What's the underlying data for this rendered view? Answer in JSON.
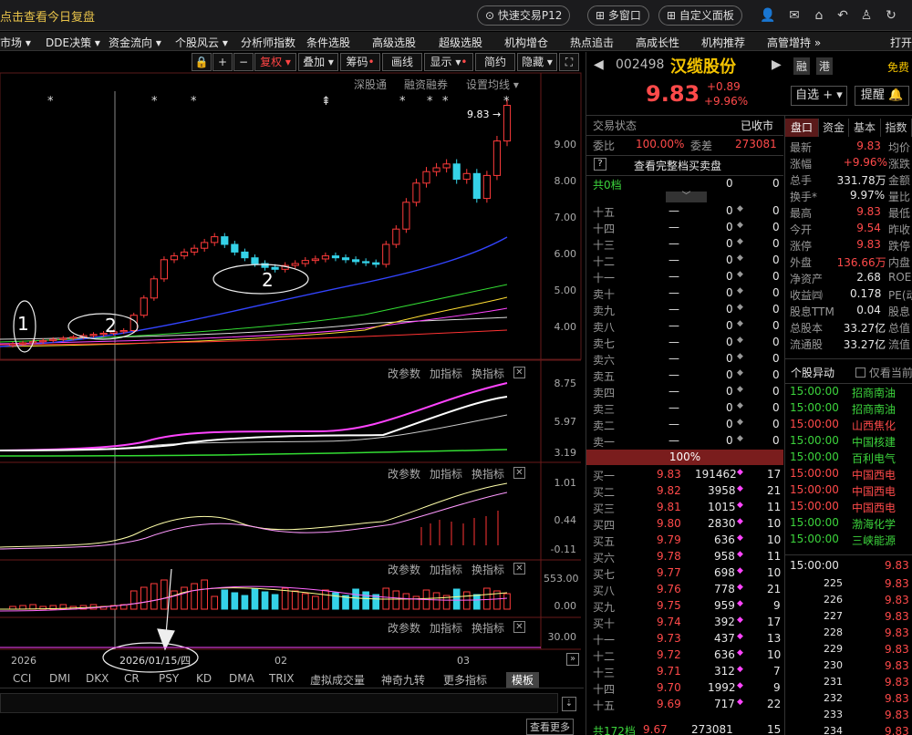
{
  "title": "点击查看今日复盘",
  "top_buttons": {
    "quick_trade": "快速交易P12",
    "multi_window": "多窗口",
    "custom_panel": "自定义面板"
  },
  "menu": [
    "市场 ▾",
    "DDE决策 ▾",
    "资金流向 ▾",
    "个股风云 ▾",
    "分析师指数",
    "条件选股",
    "高级选股",
    "超级选股",
    "机构增仓",
    "热点追击",
    "高成长性",
    "机构推荐",
    "高管增持 »",
    "打开"
  ],
  "toolbar": {
    "fuquan": "复权",
    "overlay": "叠加",
    "chips": "筹码",
    "draw": "画线",
    "display": "显示",
    "simple": "简约",
    "hide": "隐藏"
  },
  "sub_toolbar": [
    "深股通",
    "融资融券",
    "设置均线 ▾"
  ],
  "price_labels": [
    "9.00",
    "8.00",
    "7.00",
    "6.00",
    "5.00",
    "4.00"
  ],
  "price_flag": "9.83",
  "annotations": [
    "1",
    "2",
    "2"
  ],
  "panel_tools": [
    "改参数",
    "加指标",
    "换指标"
  ],
  "p2_labels": [
    "8.75",
    "5.97",
    "3.19"
  ],
  "p3_labels": [
    "1.01",
    "0.44",
    "-0.11"
  ],
  "p4_labels": [
    "553.00",
    "0.00"
  ],
  "p5_labels": [
    "30.00"
  ],
  "x_labels": [
    "2026",
    "2026/01/15/四",
    "02",
    "03"
  ],
  "ind_tabs": [
    "CCI",
    "DMI",
    "DKX",
    "CR",
    "PSY",
    "KD",
    "DMA",
    "TRIX",
    "虚拟成交量",
    "神奇九转",
    "更多指标",
    "模板"
  ],
  "bottom_btn": "查看更多",
  "chart_data": {
    "type": "candlestick",
    "closes": [
      3.6,
      3.63,
      3.66,
      3.69,
      3.72,
      3.75,
      3.78,
      3.82,
      3.85,
      3.88,
      3.92,
      3.95,
      4.35,
      4.8,
      5.3,
      5.8,
      5.9,
      6.0,
      6.1,
      6.25,
      6.4,
      6.2,
      6.0,
      5.85,
      5.7,
      5.6,
      5.55,
      5.65,
      5.7,
      5.78,
      5.82,
      5.9,
      5.85,
      5.8,
      5.75,
      5.72,
      5.68,
      6.2,
      6.6,
      7.3,
      7.8,
      8.1,
      8.2,
      8.3,
      7.9,
      8.05,
      7.4,
      8.0,
      8.9,
      9.83
    ],
    "y_range": [
      3.2,
      10.2
    ]
  },
  "right": {
    "code": "002498",
    "name": "汉缆股份",
    "badges": [
      "融",
      "港"
    ],
    "free": "免费",
    "price": "9.83",
    "change": "+0.89",
    "change_pct": "+9.96%",
    "watch_btn": "自选 +",
    "alert_btn": "提醒",
    "status_label": "交易状态",
    "status": "已收市",
    "weibi_label": "委比",
    "weibi": "100.00%",
    "weicha_label": "委差",
    "weicha": "273081",
    "full_book": "查看完整档买卖盘",
    "total_sell_label": "共0档",
    "total_sell_v1": "0",
    "total_sell_v2": "0",
    "sells": [
      "十五",
      "十四",
      "十三",
      "十二",
      "十一",
      "卖十",
      "卖九",
      "卖八",
      "卖七",
      "卖六",
      "卖五",
      "卖四",
      "卖三",
      "卖二",
      "卖一"
    ],
    "dash": "—",
    "zero": "0",
    "pct_bar": "100%",
    "buys": [
      [
        "买一",
        "9.83",
        "191462",
        "17"
      ],
      [
        "买二",
        "9.82",
        "3958",
        "21"
      ],
      [
        "买三",
        "9.81",
        "1015",
        "11"
      ],
      [
        "买四",
        "9.80",
        "2830",
        "10"
      ],
      [
        "买五",
        "9.79",
        "636",
        "10"
      ],
      [
        "买六",
        "9.78",
        "958",
        "11"
      ],
      [
        "买七",
        "9.77",
        "698",
        "10"
      ],
      [
        "买八",
        "9.76",
        "778",
        "21"
      ],
      [
        "买九",
        "9.75",
        "959",
        "9"
      ],
      [
        "买十",
        "9.74",
        "392",
        "17"
      ],
      [
        "十一",
        "9.73",
        "437",
        "13"
      ],
      [
        "十二",
        "9.72",
        "636",
        "10"
      ],
      [
        "十三",
        "9.71",
        "312",
        "7"
      ],
      [
        "十四",
        "9.70",
        "1992",
        "9"
      ],
      [
        "十五",
        "9.69",
        "717",
        "22"
      ]
    ],
    "total_buy": [
      "共172档",
      "9.67",
      "273081",
      "15"
    ],
    "tabs": [
      "盘口",
      "资金",
      "基本",
      "指数"
    ],
    "stats": [
      [
        "最新",
        "9.83",
        "均价"
      ],
      [
        "涨幅",
        "+9.96%",
        "涨跌"
      ],
      [
        "总手",
        "331.78万",
        "金额"
      ],
      [
        "换手*",
        "9.97%",
        "量比"
      ],
      [
        "最高",
        "9.83",
        "最低"
      ],
      [
        "今开",
        "9.54",
        "昨收"
      ],
      [
        "涨停",
        "9.83",
        "跌停"
      ],
      [
        "外盘",
        "136.66万",
        "内盘"
      ],
      [
        "净资产",
        "2.68",
        "ROE"
      ],
      [
        "收益㈣",
        "0.178",
        "PE(动"
      ],
      [
        "股息TTM",
        "0.04",
        "股息"
      ],
      [
        "总股本",
        "33.27亿",
        "总值"
      ],
      [
        "流通股",
        "33.27亿",
        "流值"
      ]
    ],
    "move_title": "个股异动",
    "move_opt": "仅看当前",
    "moves": [
      [
        "15:00:00",
        "招商南油",
        "g"
      ],
      [
        "15:00:00",
        "招商南油",
        "g"
      ],
      [
        "15:00:00",
        "山西焦化",
        "r"
      ],
      [
        "15:00:00",
        "中国核建",
        "g"
      ],
      [
        "15:00:00",
        "百利电气",
        "g"
      ],
      [
        "15:00:00",
        "中国西电",
        "r"
      ],
      [
        "15:00:00",
        "中国西电",
        "r"
      ],
      [
        "15:00:00",
        "中国西电",
        "r"
      ],
      [
        "15:00:00",
        "渤海化学",
        "g"
      ],
      [
        "15:00:00",
        "三峡能源",
        "g"
      ]
    ],
    "ticks_time": "15:00:00",
    "ticks_price": "9.83",
    "ticks": [
      "225",
      "226",
      "227",
      "228",
      "229",
      "230",
      "231",
      "232",
      "233",
      "234"
    ]
  }
}
